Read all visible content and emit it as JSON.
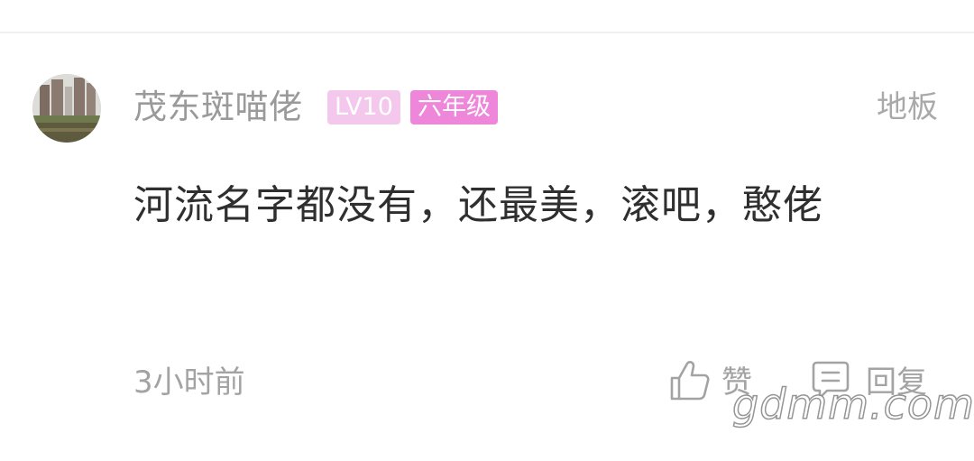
{
  "comment": {
    "username": "茂东斑喵佬",
    "level_badge": "LV10",
    "grade_badge": "六年级",
    "floor": "地板",
    "content": "河流名字都没有，还最美，滚吧，憨佬",
    "timestamp": "3小时前",
    "like_label": "赞",
    "reply_label": "回复"
  },
  "watermark": "gdmm.com",
  "icons": {
    "like": "thumbs-up-icon",
    "reply": "comment-icon"
  },
  "colors": {
    "level_badge": "#f4c8ec",
    "grade_badge": "#ee86da",
    "username": "#9a9a9a",
    "content": "#2f2f2f",
    "meta": "#a3a3a3"
  }
}
